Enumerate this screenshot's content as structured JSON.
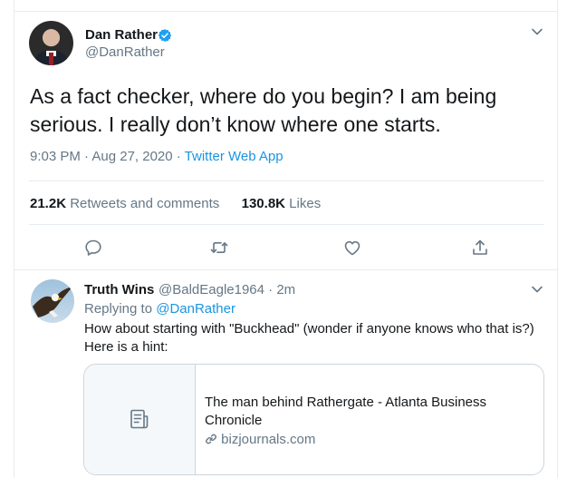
{
  "tweet": {
    "author_name": "Dan Rather",
    "author_handle": "@DanRather",
    "text": "As a fact checker, where do you begin? I am being serious. I really don’t know where one starts.",
    "time": "9:03 PM · Aug 27, 2020 · ",
    "app": "Twitter Web App",
    "retweets_count": "21.2K",
    "retweets_label": "Retweets and comments",
    "likes_count": "130.8K",
    "likes_label": "Likes"
  },
  "reply": {
    "author_name": "Truth Wins",
    "author_handle": "@BaldEagle1964 · 2m",
    "replying_prefix": "Replying to ",
    "replying_to": "@DanRather",
    "text_line1": "How about starting with \"Buckhead\"  (wonder if anyone knows who that is?)",
    "text_line2": "Here is a hint:",
    "card": {
      "title": "The man behind Rathergate - Atlanta Business Chronicle",
      "domain": "bizjournals.com"
    }
  },
  "colors": {
    "accent": "#1b95e0",
    "verified": "#1da1f2",
    "muted": "#657786",
    "border": "#e6ecf0"
  },
  "icons": [
    "verified-badge-icon",
    "chevron-down-icon",
    "reply-icon",
    "retweet-icon",
    "like-icon",
    "share-icon",
    "article-icon",
    "link-icon"
  ]
}
